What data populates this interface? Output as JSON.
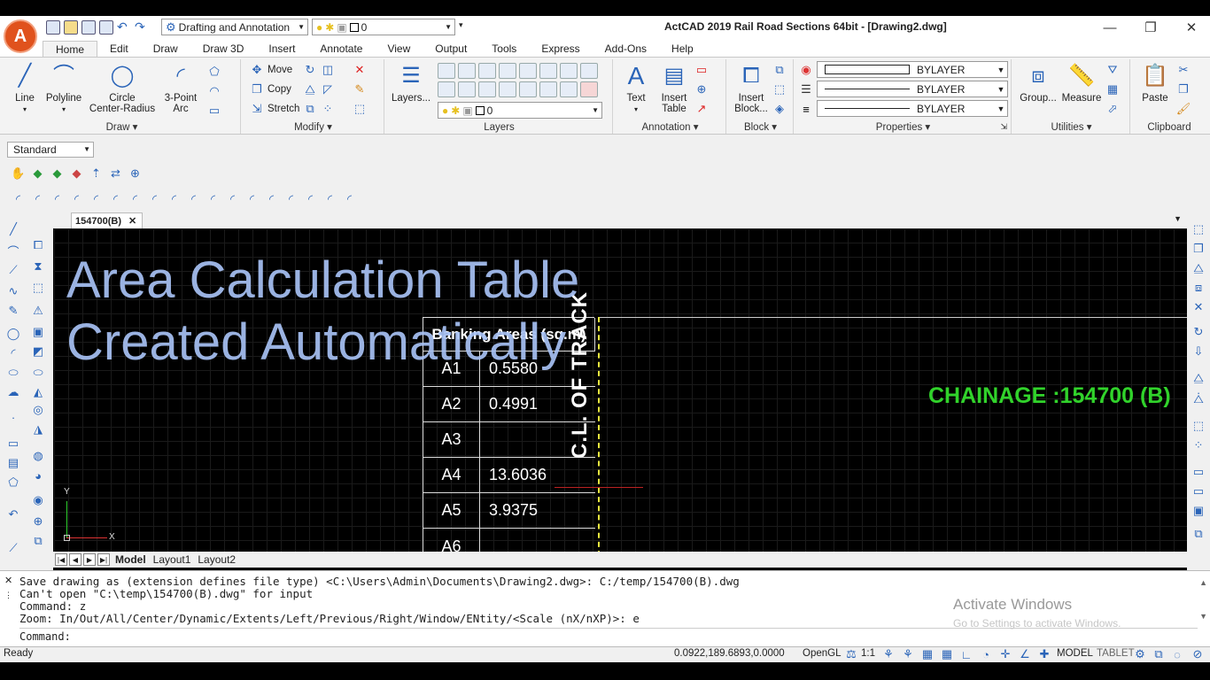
{
  "app": {
    "logo": "A",
    "title": "ActCAD 2019 Rail Road Sections 64bit - [Drawing2.dwg]",
    "workspace": "Drafting and Annotation",
    "layer_quick": "0"
  },
  "menu": [
    "Home",
    "Edit",
    "Draw",
    "Draw 3D",
    "Insert",
    "Annotate",
    "View",
    "Output",
    "Tools",
    "Express",
    "Add-Ons",
    "Help"
  ],
  "ribbon": {
    "draw": {
      "line": "Line",
      "polyline": "Polyline",
      "circle": "Circle",
      "circle_sub": "Center-Radius",
      "arc": "3-Point",
      "arc_sub": "Arc",
      "label": "Draw"
    },
    "modify": {
      "move": "Move",
      "copy": "Copy",
      "stretch": "Stretch",
      "label": "Modify"
    },
    "layers": {
      "layers_btn": "Layers...",
      "current": "0",
      "label": "Layers"
    },
    "annotation": {
      "text": "Text",
      "insert": "Insert",
      "table": "Table",
      "label": "Annotation"
    },
    "block": {
      "insert": "Insert",
      "block": "Block...",
      "label": "Block"
    },
    "properties": {
      "color": "BYLAYER",
      "linetype": "BYLAYER",
      "lineweight": "BYLAYER",
      "label": "Properties"
    },
    "utilities": {
      "group": "Group...",
      "measure": "Measure",
      "label": "Utilities"
    },
    "clipboard": {
      "paste": "Paste",
      "label": "Clipboard"
    }
  },
  "toolbar": {
    "style": "Standard"
  },
  "document_tab": "154700(B)",
  "drawing": {
    "overlay_line1": "Area Calculation Table",
    "overlay_line2": "Created Automatically",
    "table_header": "Banking Areas (sq.m)",
    "rows": [
      {
        "label": "A1",
        "value": "0.5580"
      },
      {
        "label": "A2",
        "value": "0.4991"
      },
      {
        "label": "A3",
        "value": ""
      },
      {
        "label": "A4",
        "value": "13.6036"
      },
      {
        "label": "A5",
        "value": "3.9375"
      },
      {
        "label": "A6",
        "value": ""
      }
    ],
    "centerline": "C.L. OF TRACK",
    "chainage": "CHAINAGE :154700 (B)",
    "ucs_x": "X",
    "ucs_y": "Y"
  },
  "layout_tabs": [
    "Model",
    "Layout1",
    "Layout2"
  ],
  "command": {
    "lines": [
      "Save drawing as (extension defines file type) <C:\\Users\\Admin\\Documents\\Drawing2.dwg>: C:/temp/154700(B).dwg",
      "Can't open \"C:\\temp\\154700(B).dwg\" for input",
      "Command: z",
      "Zoom:  In/Out/All/Center/Dynamic/Extents/Left/Previous/Right/Window/ENtity/<Scale (nX/nXP)>: e"
    ],
    "prompt": "Command:"
  },
  "watermark": {
    "title": "Activate Windows",
    "sub": "Go to Settings to activate Windows."
  },
  "status": {
    "ready": "Ready",
    "coords": "0.0922,189.6893,0.0000",
    "renderer": "OpenGL",
    "scale": "1:1",
    "model": "MODEL",
    "tablet": "TABLET"
  }
}
